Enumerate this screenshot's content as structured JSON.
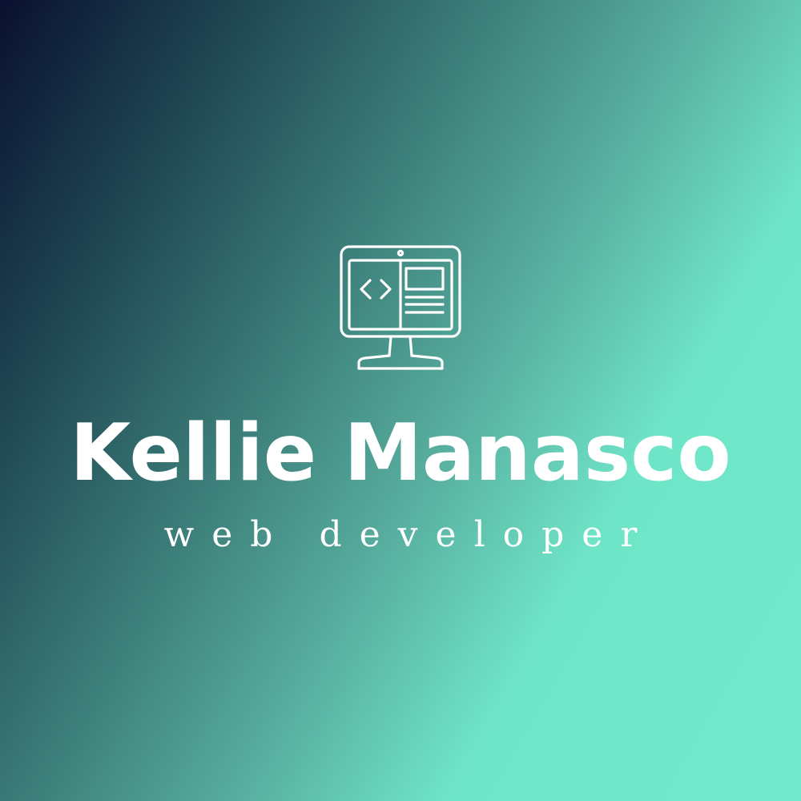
{
  "logo": {
    "icon": "monitor-code-icon",
    "name": "Kellie Manasco",
    "tagline": "web developer"
  },
  "colors": {
    "gradient_start": "#0a1030",
    "gradient_end": "#70e9cb",
    "text": "#ffffff"
  }
}
